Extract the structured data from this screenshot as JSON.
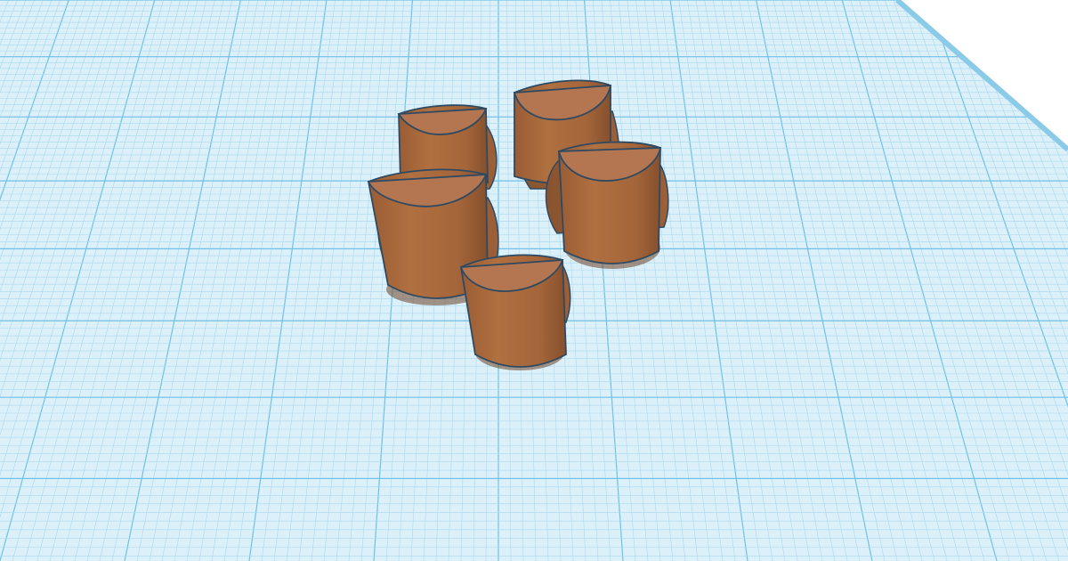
{
  "viewport": {
    "background": "#ffffff"
  },
  "workplane": {
    "fill_color": "#dcf0fa",
    "minor_grid_color": "#a9d8ee",
    "major_grid_color": "#6fc1e6",
    "edge_color": "#8ccbe8"
  },
  "shapes": {
    "material_color": "#a8693f",
    "shadow_color": "#6e4426",
    "outline_color": "#2e4a62",
    "top_face_color": "#b37650",
    "count": 5,
    "type": "half-cylinder-icon"
  }
}
